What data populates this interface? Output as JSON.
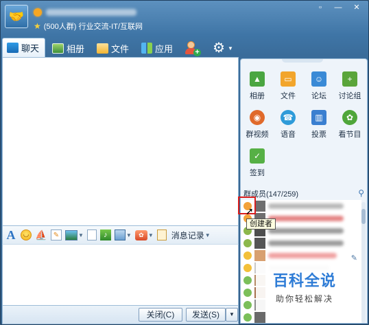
{
  "title_bar": {
    "group_description": "(500人群) 行业交流-IT/互联网",
    "minimize": "—",
    "restore": "▫",
    "close": "✕"
  },
  "tabs": [
    {
      "label": "聊天",
      "icon": "chat-icon"
    },
    {
      "label": "相册",
      "icon": "album-icon"
    },
    {
      "label": "文件",
      "icon": "folder-icon"
    },
    {
      "label": "应用",
      "icon": "apps-icon"
    }
  ],
  "toolbar": {
    "history_label": "消息记录"
  },
  "bottom": {
    "close_label": "关闭(C)",
    "send_label": "发送(S)"
  },
  "apps": [
    {
      "label": "相册",
      "icon": "album-icon",
      "color": "#4aa641"
    },
    {
      "label": "文件",
      "icon": "folder-icon",
      "color": "#f2a52b"
    },
    {
      "label": "论坛",
      "icon": "forum-icon",
      "color": "#3a8ad6"
    },
    {
      "label": "讨论组",
      "icon": "discussion-icon",
      "color": "#5aa53a"
    },
    {
      "label": "群视频",
      "icon": "video-icon",
      "color": "#e06a2b"
    },
    {
      "label": "语音",
      "icon": "voice-icon",
      "color": "#2e9bd9"
    },
    {
      "label": "投票",
      "icon": "vote-icon",
      "color": "#3a7fd0"
    },
    {
      "label": "看节目",
      "icon": "show-icon",
      "color": "#4fa63a"
    },
    {
      "label": "签到",
      "icon": "checkin-icon",
      "color": "#56b045"
    }
  ],
  "members": {
    "header": "群成员(147/259)"
  },
  "tooltip": "创建者",
  "watermark": {
    "title": "百科全说",
    "subtitle": "助你轻松解决"
  },
  "colors": {
    "accent": "#3f75a6",
    "highlight": "#d91d1d"
  }
}
